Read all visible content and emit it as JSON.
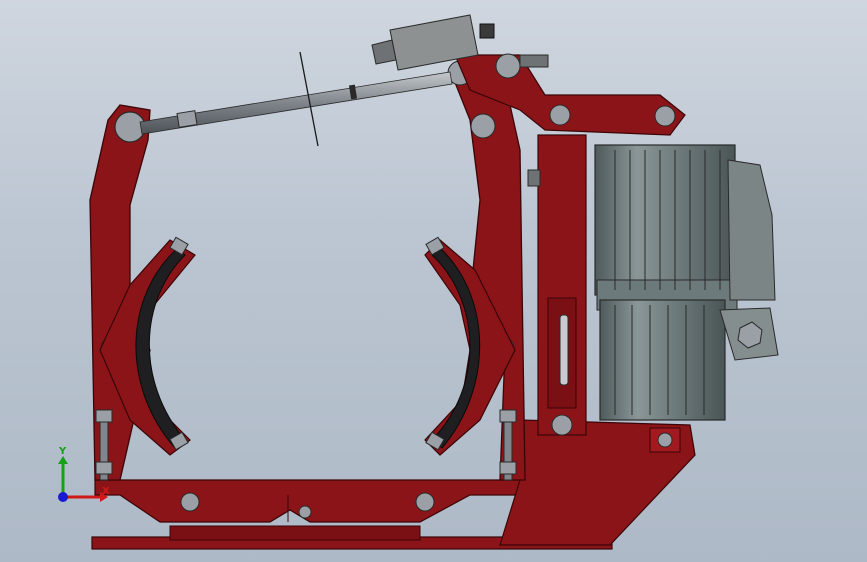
{
  "viewport": {
    "background_top": "#cfd6df",
    "background_bottom": "#aeb9c7"
  },
  "model": {
    "frame_color": "#8b1418",
    "frame_edge": "#3a0507",
    "lining_color": "#1f1f22",
    "actuator_color": "#6d7a7b",
    "hardware_color": "#9aa0a6"
  },
  "triad": {
    "x_label": "X",
    "y_label": "Y",
    "x_color": "#d01818",
    "y_color": "#18a018",
    "z_color": "#1a1ad0",
    "icon": "coordinate-triad-icon"
  }
}
